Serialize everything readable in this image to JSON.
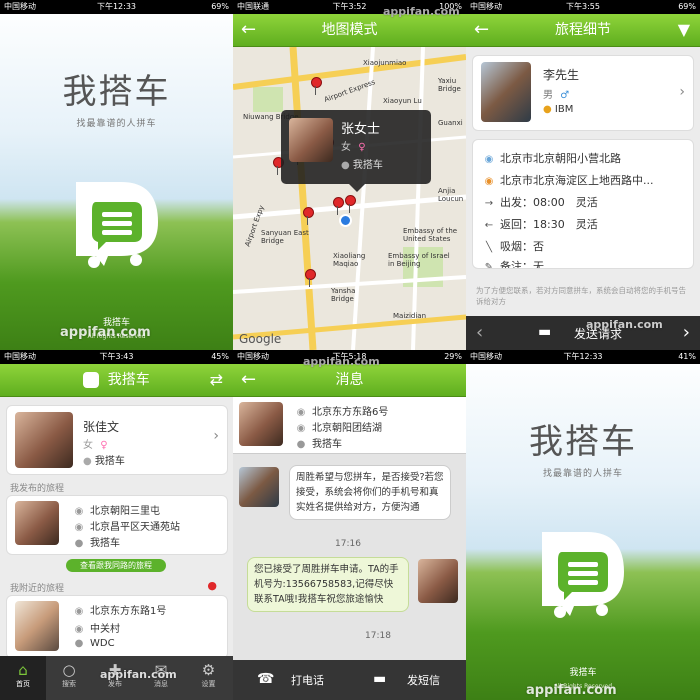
{
  "panel1": {
    "status": {
      "carrier": "中国移动",
      "time": "下午12:33",
      "battery": "69%"
    },
    "app_name": "我搭车",
    "slogan": "找最靠谱的人拼车",
    "brand": "我搭车",
    "rights": "All Rights Reserved",
    "watermark": "appifan.com"
  },
  "panel2": {
    "status": {
      "carrier": "中国联通",
      "time": "下午3:52",
      "battery": "100%"
    },
    "title": "地图模式",
    "popup": {
      "name": "张女士",
      "gender": "女",
      "brand": "我搭车"
    },
    "map_labels": [
      "Airport Express",
      "Xiaojunmiao",
      "Yaxiu Bridge",
      "Niuwang Bridge",
      "Xiaoyun Lu",
      "Guanxi",
      "Anjia Loucun",
      "Sanyuan East Bridge",
      "Embassy of the United States",
      "Xiaoliang Maqiao",
      "Embassy of Israel in Beijing",
      "Yansha Bridge",
      "Maizidian",
      "Airport Expy",
      "Google"
    ],
    "watermark": "appifan.com"
  },
  "panel3": {
    "status": {
      "carrier": "中国移动",
      "time": "下午3:55",
      "battery": "69%"
    },
    "title": "旅程细节",
    "profile": {
      "name": "李先生",
      "gender": "男",
      "company": "IBM"
    },
    "rows": [
      {
        "icon": "start-location-icon",
        "text": "北京市北京朝阳小营北路"
      },
      {
        "icon": "end-location-icon",
        "text": "北京市北京海淀区上地西路中..."
      },
      {
        "icon": "depart-icon",
        "text": "出发：08:00　灵活"
      },
      {
        "icon": "return-icon",
        "text": "返回：18:30　灵活"
      },
      {
        "icon": "smoke-icon",
        "text": "吸烟：否"
      },
      {
        "icon": "note-icon",
        "text": "备注：无"
      }
    ],
    "hint": "为了方便您联系，若对方同意拼车，系统会自动将您的手机号告诉给对方",
    "send_request": "发送请求",
    "watermark": "appifan.com"
  },
  "panel4": {
    "status": {
      "carrier": "中国移动",
      "time": "下午3:43",
      "battery": "45%"
    },
    "title": "我搭车",
    "profile": {
      "name": "张佳文",
      "gender": "女",
      "brand": "我搭车"
    },
    "my_trips_title": "我发布的旅程",
    "my_trip": {
      "from": "北京朝阳三里屯",
      "to": "北京昌平区天通苑站",
      "brand": "我搭车"
    },
    "view_button": "查看跟我同路的旅程",
    "nearby_title": "我附近的旅程",
    "nearby_trip": {
      "from": "北京东方东路1号",
      "to": "中关村",
      "company": "WDC"
    },
    "tabs": [
      {
        "icon": "home-icon",
        "label": "首页"
      },
      {
        "icon": "search-icon",
        "label": "搜索"
      },
      {
        "icon": "publish-icon",
        "label": "发布"
      },
      {
        "icon": "message-icon",
        "label": "消息"
      },
      {
        "icon": "settings-icon",
        "label": "设置"
      }
    ],
    "watermark": "appifan.com"
  },
  "panel5": {
    "status": {
      "carrier": "中国移动",
      "time": "下午5:18",
      "battery": "29%"
    },
    "title": "消息",
    "header": {
      "from": "北京东方东路6号",
      "to": "北京朝阳团结湖",
      "brand": "我搭车"
    },
    "messages": [
      {
        "text": "周胜希望与您拼车，是否接受?若您接受，系统会将你们的手机号和真实姓名提供给对方，方便沟通",
        "time": "17:16"
      },
      {
        "text": "您已接受了周胜拼车申请。TA的手机号为:13566758583,记得尽快联系TA哦!我搭车祝您旅途愉快",
        "time": "17:18"
      }
    ],
    "call": "打电话",
    "sms": "发短信",
    "watermark": "appifan.com"
  },
  "panel6": {
    "status": {
      "carrier": "中国移动",
      "time": "下午12:33",
      "battery": "41%"
    },
    "app_name": "我搭车",
    "slogan": "找最靠谱的人拼车",
    "brand": "我搭车",
    "rights": "All Rights Reserved",
    "watermark": "appifan.com"
  }
}
